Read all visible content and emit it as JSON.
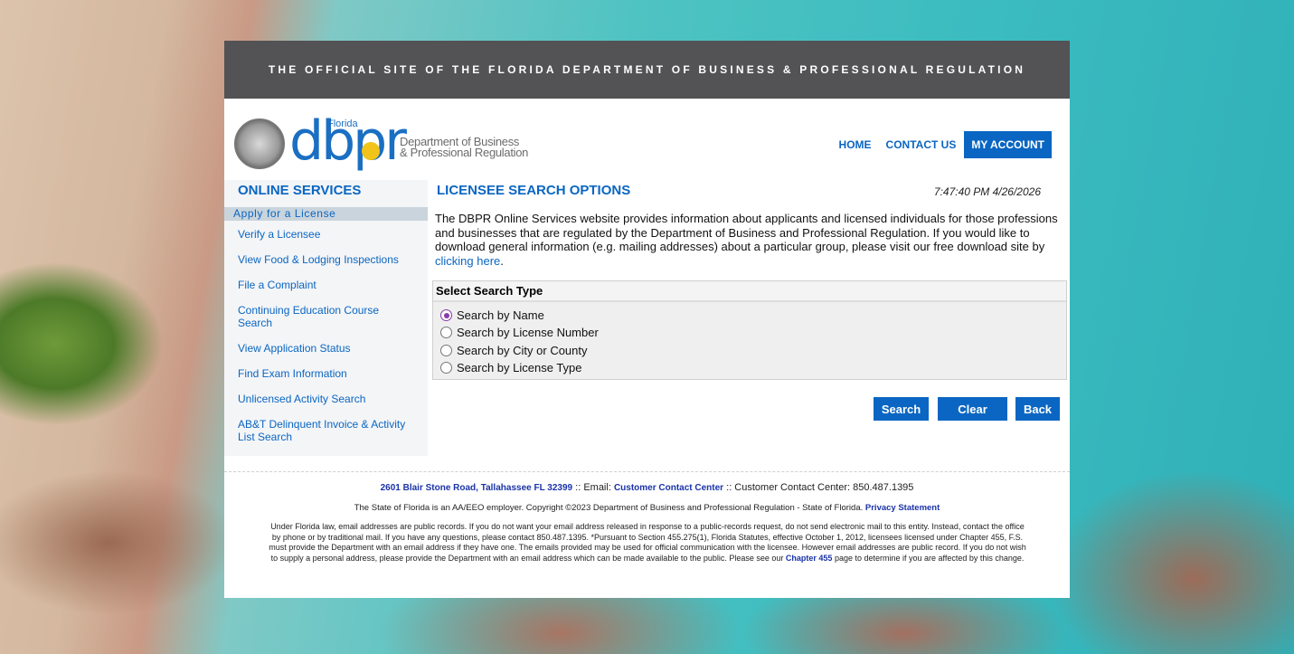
{
  "banner": "THE OFFICIAL SITE OF THE FLORIDA DEPARTMENT OF BUSINESS & PROFESSIONAL REGULATION",
  "logo": {
    "florida": "Florida",
    "dbpr": "dbpr",
    "line1": "Department of Business",
    "line2": "& Professional Regulation"
  },
  "topnav": {
    "home": "HOME",
    "contact": "CONTACT US",
    "account": "MY ACCOUNT"
  },
  "sidebar": {
    "title": "ONLINE SERVICES",
    "items": [
      "Apply for a License",
      "Verify a Licensee",
      "View Food & Lodging Inspections",
      "File a Complaint",
      "Continuing Education Course Search",
      "View Application Status",
      "Find Exam Information",
      "Unlicensed Activity Search",
      "AB&T Delinquent Invoice & Activity List Search"
    ]
  },
  "main": {
    "title": "LICENSEE SEARCH OPTIONS",
    "timestamp": "7:47:40 PM 4/26/2026",
    "description": "The DBPR Online Services website provides information about applicants and licensed individuals for those professions and businesses that are regulated by the Department of Business and Professional Regulation. If you would like to download general information (e.g. mailing addresses) about a particular group, please visit our free download site by ",
    "link": "clicking here",
    "period": "."
  },
  "search": {
    "heading": "Select Search Type",
    "options": [
      "Search by Name",
      "Search by License Number",
      "Search by City or County",
      "Search by License Type"
    ],
    "selected": "Search by Name"
  },
  "buttons": {
    "search": "Search",
    "clear": "Clear",
    "back": "Back"
  },
  "footer": {
    "address": "2601 Blair Stone Road, Tallahassee FL 32399",
    "email_label": " :: Email: ",
    "email_link": "Customer Contact Center",
    "phone": " :: Customer Contact Center: 850.487.1395",
    "copyright": "The State of Florida is an AA/EEO employer. Copyright ©2023 Department of Business and Professional Regulation - State of Florida. ",
    "privacy": "Privacy Statement",
    "legal": "Under Florida law, email addresses are public records. If you do not want your email address released in response to a public-records request, do not send electronic mail to this entity. Instead, contact the office by phone or by traditional mail. If you have any questions, please contact 850.487.1395. *Pursuant to Section 455.275(1), Florida Statutes, effective October 1, 2012, licensees licensed under Chapter 455, F.S. must provide the Department with an email address if they have one. The emails provided may be used for official communication with the licensee. However email addresses are public record. If you do not wish to supply a personal address, please provide the Department with an email address which can be made available to the public. Please see our ",
    "chapter": "Chapter 455",
    "legal_end": " page to determine if you are affected by this change."
  }
}
